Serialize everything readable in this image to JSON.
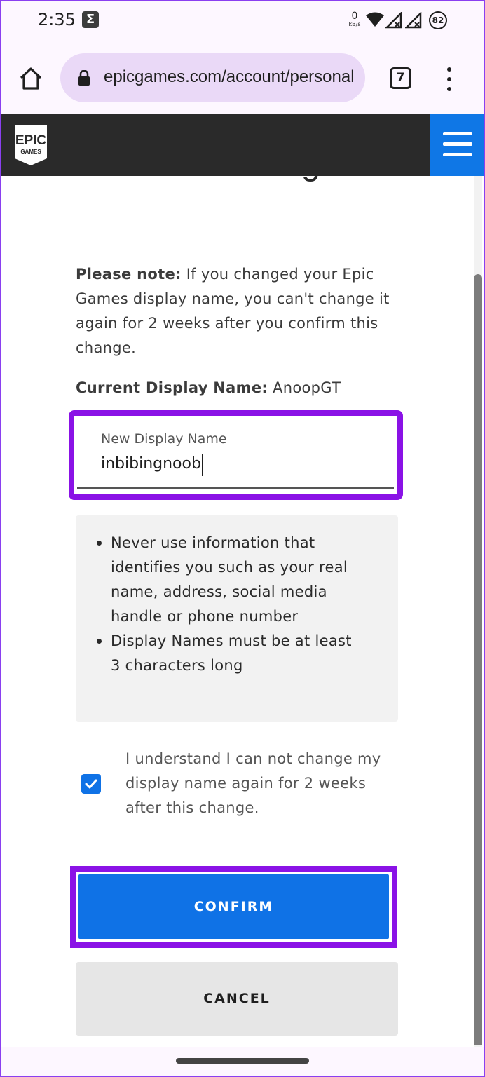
{
  "status_bar": {
    "time": "2:35",
    "notification_icon": "sigma-icon",
    "network_speed_value": "0",
    "network_speed_unit": "kB/s",
    "battery_level": "82"
  },
  "browser": {
    "url": "epicgames.com/account/personal",
    "tab_count": "7",
    "home_icon": "home-icon",
    "lock_icon": "lock-icon",
    "menu_icon": "more-vert-icon"
  },
  "site_header": {
    "logo_top": "EPIC",
    "logo_bottom": "GAMES",
    "menu_icon": "hamburger-menu-icon",
    "accent_color": "#0f77e6"
  },
  "page": {
    "title_fragment": "name change",
    "note_label": "Please note:",
    "note_text": " If you changed your Epic Games display name, you can't change it again for 2 weeks after you confirm this change.",
    "current_name_label": "Current Display Name:",
    "current_name_value": " AnoopGT",
    "new_name_field": {
      "label": "New Display Name",
      "value": "inbibingnoob"
    },
    "rules": [
      "Never use information that identifies you such as your real name, address, social media handle or phone number",
      "Display Names must be at least 3 characters long"
    ],
    "agreement": {
      "checked": true,
      "text": "I understand I can not change my display name again for 2 weeks after this change."
    },
    "confirm_label": "CONFIRM",
    "cancel_label": "CANCEL",
    "highlight_color": "#8a12e6",
    "button_color": "#0f72e6"
  }
}
